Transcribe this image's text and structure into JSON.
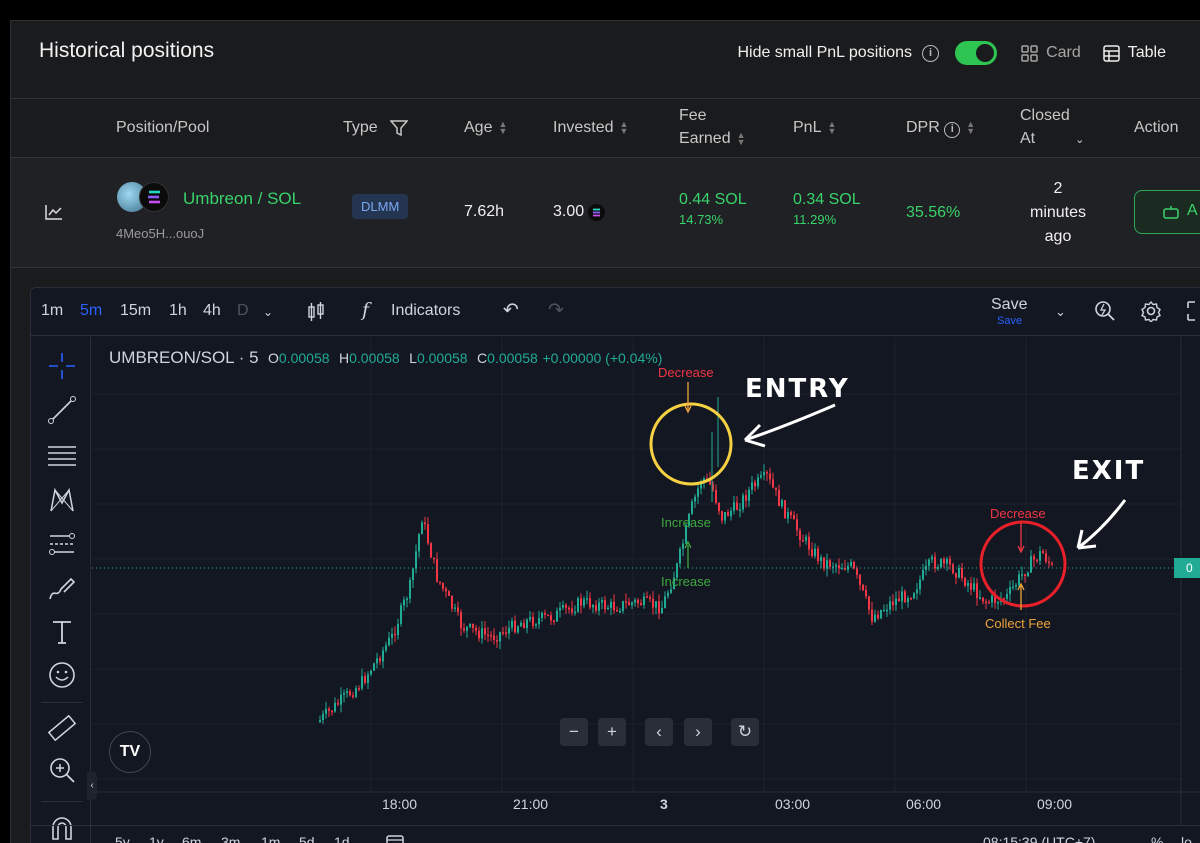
{
  "header": {
    "title": "Historical positions",
    "hide_small_label": "Hide small PnL positions",
    "card_label": "Card",
    "table_label": "Table"
  },
  "table": {
    "columns": [
      "Position/Pool",
      "Type",
      "Age",
      "Invested",
      "Fee",
      "Earned",
      "PnL",
      "DPR",
      "Closed",
      "At",
      "Action"
    ],
    "row": {
      "pool_name": "Umbreon / SOL",
      "address": "4Meo5H...ouoJ",
      "type": "DLMM",
      "age": "7.62h",
      "invested": "3.00",
      "fee_earned": "0.44 SOL",
      "fee_earned_pct": "14.73%",
      "pnl": "0.34 SOL",
      "pnl_pct": "11.29%",
      "dpr": "35.56%",
      "closed_at_1": "2",
      "closed_at_2": "minutes",
      "closed_at_3": "ago",
      "action_label": "A"
    }
  },
  "chart_toolbar": {
    "intervals": [
      "1m",
      "5m",
      "15m",
      "1h",
      "4h",
      "D"
    ],
    "active_interval": "5m",
    "indicators_label": "Indicators",
    "save_label": "Save",
    "save_sub": "Save",
    "fx_label": "f"
  },
  "chart_legend": {
    "symbol": "UMBREON/SOL · 5",
    "o_key": "O",
    "o_val": "0.00058",
    "h_key": "H",
    "h_val": "0.00058",
    "l_key": "L",
    "l_val": "0.00058",
    "c_key": "C",
    "c_val": "0.00058",
    "change": "+0.00000 (+0.04%)"
  },
  "annotations": {
    "entry": "ENTRY",
    "exit": "EXIT",
    "decrease_1": "Decrease",
    "increase_1": "Increase",
    "increase_2": "Increase",
    "decrease_2": "Decrease",
    "collect_fee": "Collect Fee"
  },
  "chart_data": {
    "type": "candlestick",
    "x_ticks": [
      "18:00",
      "21:00",
      "3",
      "03:00",
      "06:00",
      "09:00"
    ],
    "right_axis_label": "0",
    "bottom_ranges": [
      "5y",
      "1y",
      "6m",
      "3m",
      "1m",
      "5d",
      "1d"
    ],
    "clock": "08:15:39 (UTC+7)",
    "pct_label": "%",
    "log_label": "lo",
    "colors": {
      "up": "#22ab94",
      "down": "#f23645",
      "bg": "#131722"
    }
  },
  "colors": {
    "accent_green": "#2fc553",
    "entry_circle": "#f5d142",
    "exit_circle": "#e8202a",
    "decrease": "#f23645",
    "increase": "#3ea83e",
    "collect_fee": "#f0a43a"
  }
}
